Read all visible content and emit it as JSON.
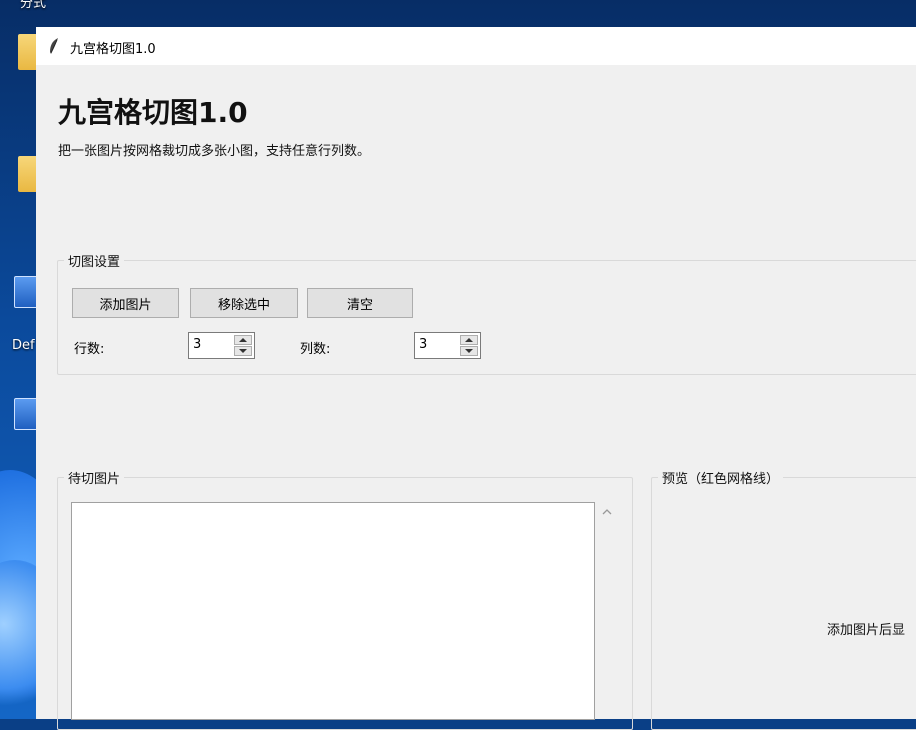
{
  "window": {
    "title": "九宫格切图1.0"
  },
  "header": {
    "title": "九宫格切图1.0",
    "description": "把一张图片按网格裁切成多张小图，支持任意行列数。"
  },
  "settings": {
    "group_label": "切图设置",
    "add_button": "添加图片",
    "remove_button": "移除选中",
    "clear_button": "清空",
    "rows_label": "行数:",
    "rows_value": "3",
    "cols_label": "列数:",
    "cols_value": "3"
  },
  "pending": {
    "group_label": "待切图片"
  },
  "preview": {
    "group_label": "预览（红色网格线）",
    "hint": "添加图片后显"
  },
  "desktop": {
    "partial_label_top": "分式",
    "partial_label_def": "Def"
  },
  "icons": {
    "app": "feather-icon",
    "scroll_up": "chevron-up-icon",
    "folder": "folder-icon",
    "monitor": "monitor-icon"
  },
  "colors": {
    "desktop_blue": "#0b4a9c",
    "window_bg": "#f0f0f0",
    "button_bg": "#e1e1e1"
  }
}
